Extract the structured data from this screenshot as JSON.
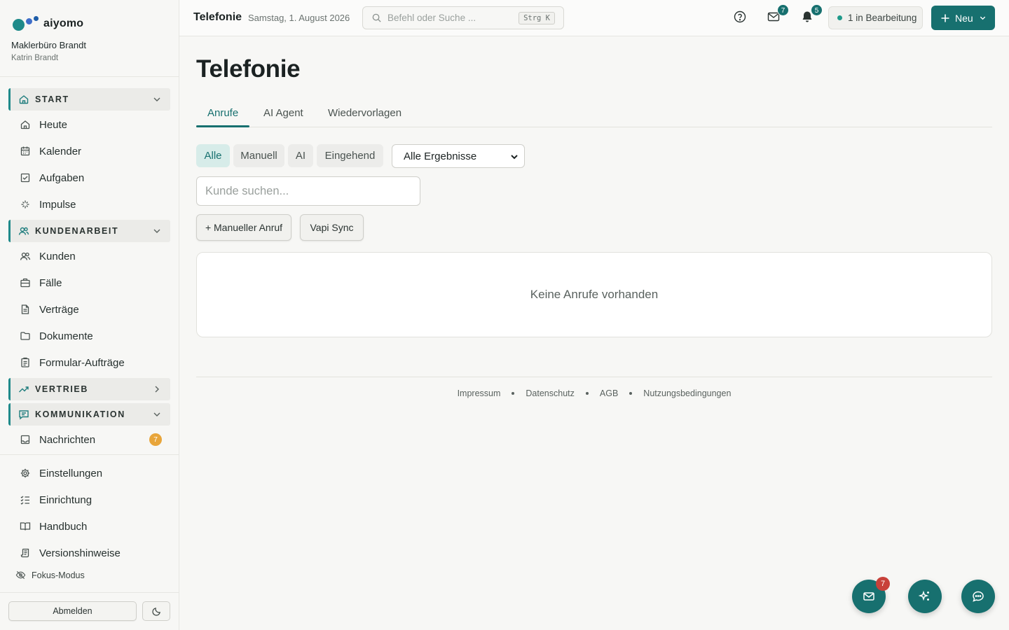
{
  "brand": {
    "name": "aiyomo"
  },
  "account": {
    "company": "Maklerbüro Brandt",
    "user": "Katrin Brandt"
  },
  "sidebar": {
    "sections": {
      "start": "START",
      "kundenarbeit": "KUNDENARBEIT",
      "vertrieb": "VERTRIEB",
      "kommunikation": "KOMMUNIKATION"
    },
    "start_items": [
      "Heute",
      "Kalender",
      "Aufgaben",
      "Impulse"
    ],
    "kundenarbeit_items": [
      "Kunden",
      "Fälle",
      "Verträge",
      "Dokumente",
      "Formular-Aufträge"
    ],
    "kommunikation_items": [
      {
        "label": "Nachrichten",
        "badge": "7"
      }
    ],
    "bottom_items": [
      "Einstellungen",
      "Einrichtung",
      "Handbuch",
      "Versionshinweise"
    ],
    "focus_mode": "Fokus-Modus",
    "logout": "Abmelden"
  },
  "topbar": {
    "title": "Telefonie",
    "date": "Samstag, 1. August 2026",
    "search_placeholder": "Befehl oder Suche ...",
    "search_shortcut": "Strg K",
    "mail_badge": "7",
    "bell_badge": "5",
    "status": "1 in Bearbeitung",
    "new_label": "Neu"
  },
  "main": {
    "title": "Telefonie",
    "tabs": [
      "Anrufe",
      "AI Agent",
      "Wiedervorlagen"
    ],
    "active_tab": "Anrufe",
    "filters": [
      "Alle",
      "Manuell",
      "AI",
      "Eingehend"
    ],
    "active_filter": "Alle",
    "result_select": "Alle Ergebnisse",
    "customer_search_placeholder": "Kunde suchen...",
    "actions": {
      "manual_call": "+ Manueller Anruf",
      "vapi_sync": "Vapi Sync"
    },
    "empty_text": "Keine Anrufe vorhanden"
  },
  "footer": {
    "links": [
      "Impressum",
      "Datenschutz",
      "AGB",
      "Nutzungsbedingungen"
    ]
  },
  "fab": {
    "mail_badge": "7"
  },
  "colors": {
    "accent": "#17706f",
    "badge_orange": "#e8a53a",
    "badge_red": "#c8413a"
  }
}
